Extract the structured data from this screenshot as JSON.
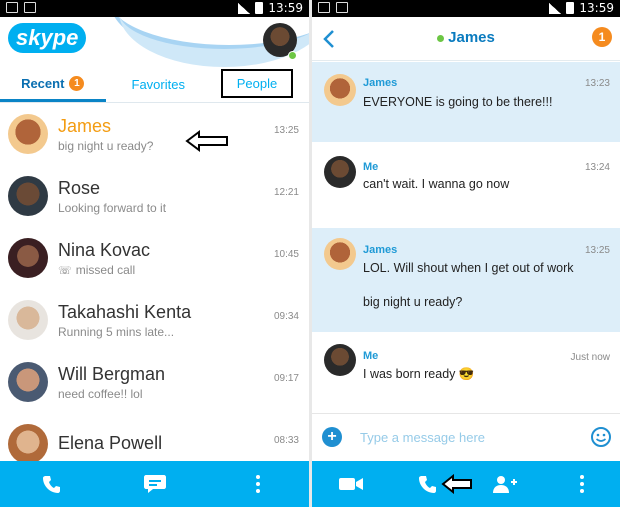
{
  "status_bar": {
    "time": "13:59"
  },
  "left": {
    "logo": "skype",
    "tabs": [
      {
        "label": "Recent",
        "badge": "1",
        "active": true
      },
      {
        "label": "Favorites"
      },
      {
        "label": "People"
      }
    ],
    "conversations": [
      {
        "name": "James",
        "preview": "big night u ready?",
        "time": "13:25",
        "avatar_color": "#b0643a"
      },
      {
        "name": "Rose",
        "preview": "Looking forward to it",
        "time": "12:21",
        "avatar_color": "#3a3a3a"
      },
      {
        "name": "Nina Kovac",
        "preview": "missed call",
        "time": "10:45",
        "avatar_color": "#7a2f3c"
      },
      {
        "name": "Takahashi Kenta",
        "preview": "Running 5 mins late...",
        "time": "09:34",
        "avatar_color": "#c9b39a"
      },
      {
        "name": "Will Bergman",
        "preview": "need coffee!! lol",
        "time": "09:17",
        "avatar_color": "#5a6a80"
      },
      {
        "name": "Elena Powell",
        "preview": "",
        "time": "08:33",
        "avatar_color": "#c98a56"
      }
    ]
  },
  "right": {
    "contact_name": "James",
    "unread_badge": "1",
    "messages": [
      {
        "sender": "James",
        "time": "13:23",
        "text": "EVERYONE is going to be there!!!",
        "incoming": true
      },
      {
        "sender": "Me",
        "time": "13:24",
        "text": "can't wait. I wanna go now",
        "incoming": false
      },
      {
        "sender": "James",
        "time": "13:25",
        "text": "LOL. Will shout when I get out of work",
        "text2": "big night u ready?",
        "incoming": true
      },
      {
        "sender": "Me",
        "time": "Just now",
        "text": "I was born ready 😎",
        "incoming": false
      }
    ],
    "composer_placeholder": "Type a message here"
  },
  "colors": {
    "skype_blue": "#00aff0",
    "badge_orange": "#f58b1f",
    "highlight_orange": "#f39c12",
    "incoming_bubble": "#ddeef9"
  }
}
